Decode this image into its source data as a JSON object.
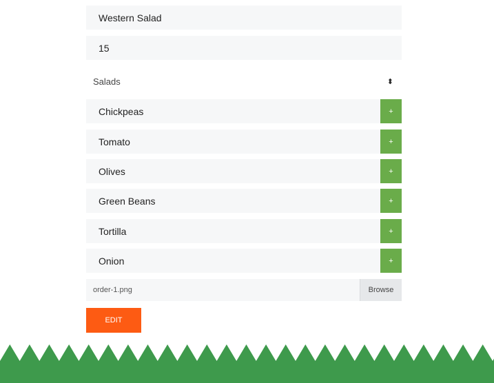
{
  "form": {
    "name_value": "Western Salad",
    "price_value": "15",
    "category_selected": "Salads",
    "ingredients": [
      {
        "label": "Chickpeas",
        "add": "+"
      },
      {
        "label": "Tomato",
        "add": "+"
      },
      {
        "label": "Olives",
        "add": "+"
      },
      {
        "label": "Green Beans",
        "add": "+"
      },
      {
        "label": "Tortilla",
        "add": "+"
      },
      {
        "label": "Onion",
        "add": "+"
      }
    ],
    "file_name": "order-1.png",
    "browse_label": "Browse",
    "edit_label": "EDIT"
  },
  "icons": {
    "select_caret": "sort-caret-icon",
    "add": "plus-icon"
  },
  "colors": {
    "accent_green": "#6aac4a",
    "edit_orange": "#fd5b13",
    "field_bg": "#f6f7f8",
    "footer_green": "#3e9a4c"
  }
}
